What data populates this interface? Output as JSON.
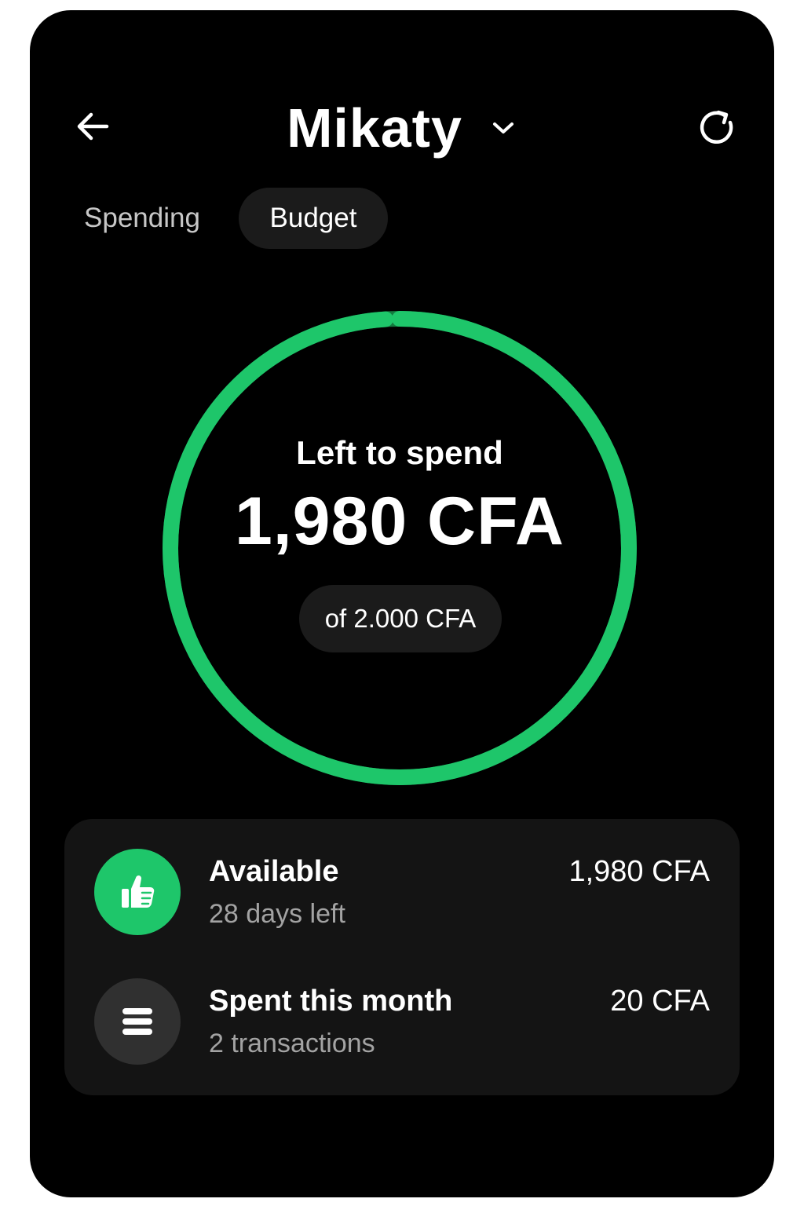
{
  "header": {
    "title": "Mikaty",
    "back_icon": "arrow-left-icon",
    "dropdown_icon": "chevron-down-icon",
    "refresh_icon": "refresh-icon"
  },
  "tabs": [
    {
      "label": "Spending",
      "active": false
    },
    {
      "label": "Budget",
      "active": true
    }
  ],
  "budget_ring": {
    "label": "Left to spend",
    "amount": "1,980 CFA",
    "total": "of 2.000 CFA",
    "fraction_remaining": 0.99,
    "color": "#1ec66a"
  },
  "summary": {
    "rows": [
      {
        "title": "Available",
        "subtitle": "28 days left",
        "value": "1,980 CFA",
        "icon": "thumbs-up-icon",
        "icon_bg": "#1ec66a"
      },
      {
        "title": "Spent this month",
        "subtitle": "2 transactions",
        "value": "20 CFA",
        "icon": "list-icon",
        "icon_bg": "#303030"
      }
    ]
  }
}
